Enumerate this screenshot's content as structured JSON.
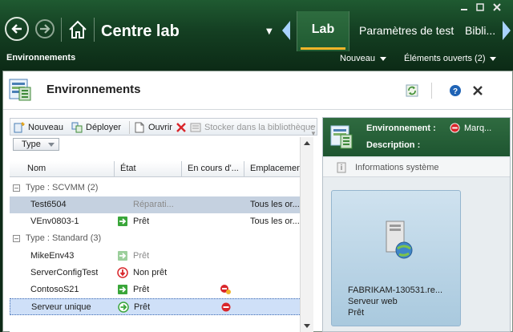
{
  "window_controls": [
    "minimize",
    "restore",
    "close"
  ],
  "header": {
    "title": "Centre lab",
    "tabs": [
      {
        "label": "Lab",
        "active": true
      },
      {
        "label": "Paramètres de test",
        "active": false
      },
      {
        "label": "Bibli...",
        "active": false
      }
    ]
  },
  "subnav": {
    "section": "Environnements",
    "new_label": "Nouveau",
    "open_items_label": "Éléments ouverts (2)"
  },
  "main": {
    "title": "Environnements",
    "toolbar": {
      "new": "Nouveau",
      "deploy": "Déployer",
      "open": "Ouvrir",
      "store": "Stocker dans la bibliothèque",
      "more": "..."
    },
    "filter": {
      "type_label": "Type"
    },
    "columns": [
      "Nom",
      "État",
      "En cours d'...",
      "Emplacement"
    ],
    "groups": [
      {
        "label": "Type : SCVMM (2)",
        "rows": [
          {
            "name": "Test6504",
            "status": "Réparati...",
            "status_icon": "none",
            "in_progress_icon": "",
            "location": "Tous les or...",
            "highlight": true
          },
          {
            "name": "VEnv0803-1",
            "status": "Prêt",
            "status_icon": "ready-arrow",
            "in_progress_icon": "",
            "location": "Tous les or..."
          }
        ]
      },
      {
        "label": "Type : Standard (3)",
        "rows": [
          {
            "name": "MikeEnv43",
            "status": "Prêt",
            "status_icon": "ready-arrow-dim",
            "in_progress_icon": "",
            "location": ""
          },
          {
            "name": "ServerConfigTest",
            "status": "Non prêt",
            "status_icon": "not-ready-down",
            "in_progress_icon": "",
            "location": ""
          },
          {
            "name": "ContosoS21",
            "status": "Prêt",
            "status_icon": "ready-arrow",
            "in_progress_icon": "stop-user-icon",
            "location": ""
          },
          {
            "name": "Serveur unique",
            "status": "Prêt",
            "status_icon": "ready-circle",
            "in_progress_icon": "stop-icon",
            "location": "",
            "selected": true
          }
        ]
      }
    ]
  },
  "details": {
    "env_label": "Environnement :",
    "env_status": "Marq...",
    "description_label": "Description :",
    "sysinfo_label": "Informations système",
    "vm": {
      "name": "FABRIKAM-130531.re...",
      "role": "Serveur web",
      "status": "Prêt"
    }
  },
  "colors": {
    "header_green": "#1f5a31",
    "tab_accent": "#f0b429",
    "ready_green": "#3aa63a",
    "stop_red": "#d9262b",
    "selection_blue": "#cfe0f8"
  }
}
